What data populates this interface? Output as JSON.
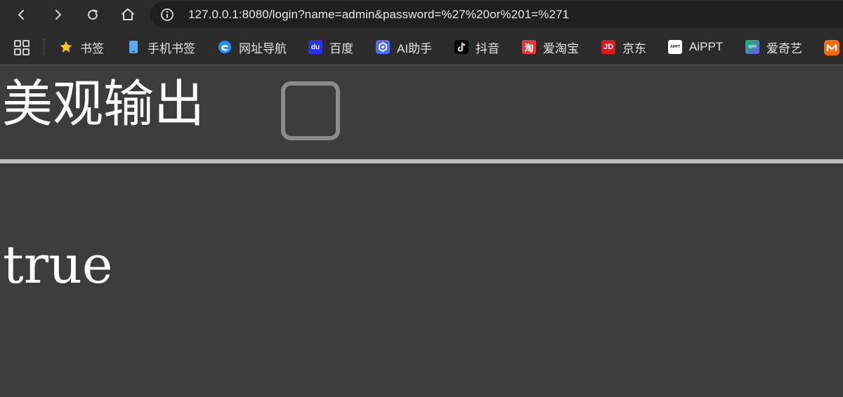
{
  "browser": {
    "url": "127.0.0.1:8080/login?name=admin&password=%27%20or%201=%271",
    "bookmarks": [
      {
        "label": "书签",
        "icon": "star-icon",
        "color": "#f5c518"
      },
      {
        "label": "手机书签",
        "icon": "phone-icon",
        "color": "#5aa9f5"
      },
      {
        "label": "网址导航",
        "icon": "edge-icon",
        "color": "#1e90ff"
      },
      {
        "label": "百度",
        "icon": "baidu-icon",
        "color": "#2932e1"
      },
      {
        "label": "AI助手",
        "icon": "ai-assistant-icon",
        "color": "#4a6cf7"
      },
      {
        "label": "抖音",
        "icon": "douyin-icon",
        "color": "#000000"
      },
      {
        "label": "爱淘宝",
        "icon": "taobao-icon",
        "color": "#e5383b"
      },
      {
        "label": "京东",
        "icon": "jd-icon",
        "color": "#d71c24"
      },
      {
        "label": "AiPPT",
        "icon": "aippt-icon",
        "color": "#ffffff"
      },
      {
        "label": "爱奇艺",
        "icon": "iqiyi-icon",
        "color": "#00c853"
      }
    ],
    "bookmark_icon_texts": {
      "baidu": "du",
      "taobao": "淘",
      "jd": "JD",
      "aippt": "AiPPT",
      "iqiyi": "iQIYI"
    }
  },
  "page": {
    "title": "美观输出",
    "result": "true"
  }
}
